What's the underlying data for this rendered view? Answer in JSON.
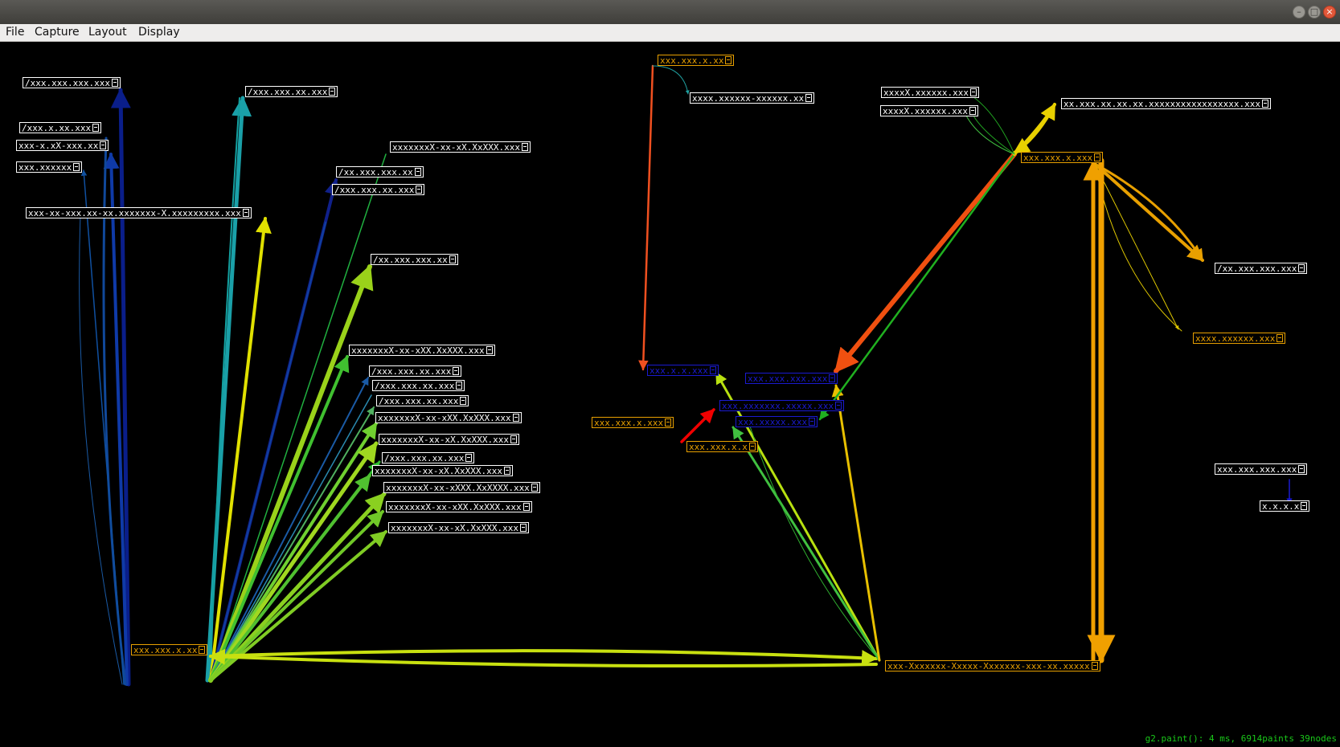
{
  "window": {
    "buttons": [
      "minimize",
      "maximize",
      "close"
    ]
  },
  "menu": {
    "items": [
      "File",
      "Capture",
      "Layout",
      "Display"
    ]
  },
  "status": {
    "text": "g2.paint(): 4 ms, 6914paints 39nodes"
  },
  "colors": {
    "node_default": "#ffffff",
    "node_orange": "#e8a000",
    "node_blue": "#1a1ad0",
    "status": "#19c819",
    "background": "#000000"
  },
  "nodes": [
    {
      "label": "/xxx.xxx.xxx.xxx",
      "style": "white"
    },
    {
      "label": "/xxx.x.xx.xxx",
      "style": "white"
    },
    {
      "label": "xxx-x.xX-xxx.xx",
      "style": "white"
    },
    {
      "label": "xxx.xxxxxx",
      "style": "white"
    },
    {
      "label": "xxx-xx-xxx.xx-xx.xxxxxxx-X.xxxxxxxxx.xxx",
      "style": "white"
    },
    {
      "label": "/xxx.xxx.xx.xxx",
      "style": "white"
    },
    {
      "label": "xxxxxxxX-xx-xX.XxXXX.xxx",
      "style": "white"
    },
    {
      "label": "/xx.xxx.xxx.xx",
      "style": "white"
    },
    {
      "label": "/xxx.xxx.xx.xxx",
      "style": "white"
    },
    {
      "label": "/xx.xxx.xxx.xx",
      "style": "white"
    },
    {
      "label": "xxxxxxxX-xx-xXX.XxXXX.xxx",
      "style": "white"
    },
    {
      "label": "/xxx.xxx.xx.xxx",
      "style": "white"
    },
    {
      "label": "/xxx.xxx.xx.xxx",
      "style": "white"
    },
    {
      "label": "/xxx.xxx.xx.xxx",
      "style": "white"
    },
    {
      "label": "xxxxxxxX-xx-xXX.XxXXX.xxx",
      "style": "white"
    },
    {
      "label": "xxxxxxxX-xx-xX.XxXXX.xxx",
      "style": "white"
    },
    {
      "label": "/xxx.xxx.xx.xxx",
      "style": "white"
    },
    {
      "label": "xxxxxxxX-xx-xX.XxXXX.xxx",
      "style": "white"
    },
    {
      "label": "xxxxxxxX-xx-xXXX.XxXXXX.xxx",
      "style": "white"
    },
    {
      "label": "xxxxxxxX-xx-xXX.XxXXX.xxx",
      "style": "white"
    },
    {
      "label": "xxxxxxxX-xx-xX.XxXXX.xxx",
      "style": "white"
    },
    {
      "label": "xxx.xxx.x.xx",
      "style": "orange"
    },
    {
      "label": "xxx.xxx.x.xx",
      "style": "orange"
    },
    {
      "label": "xxxx.xxxxxx-xxxxxx.xx",
      "style": "white"
    },
    {
      "label": "xxx.x.x.xxx",
      "style": "blue"
    },
    {
      "label": "xxx.xxx.xxx.xxx",
      "style": "blue"
    },
    {
      "label": "xxx.xxxxxxx.xxxxx.xxx",
      "style": "blue"
    },
    {
      "label": "xxx.xxx.x.xxx",
      "style": "orange"
    },
    {
      "label": "xxx.xxxxx.xxx",
      "style": "blue"
    },
    {
      "label": "xxx.xxx.x.x",
      "style": "orange"
    },
    {
      "label": "xxxxX.xxxxxx.xxx",
      "style": "white"
    },
    {
      "label": "xxxxX.xxxxxx.xxx",
      "style": "white"
    },
    {
      "label": "xx.xxx.xx.xx.xx.xxxxxxxxxxxxxxxxx.xxx",
      "style": "white"
    },
    {
      "label": "xxx.xxx.x.xxx",
      "style": "orange"
    },
    {
      "label": "/xx.xxx.xxx.xxx",
      "style": "white"
    },
    {
      "label": "xxxx.xxxxxx.xxx",
      "style": "orange"
    },
    {
      "label": "xxx.xxx.xxx.xxx",
      "style": "white"
    },
    {
      "label": "x.x.x.x",
      "style": "white"
    },
    {
      "label": "xxx-Xxxxxxx-Xxxxx-Xxxxxxx-xxx-xx.xxxxx",
      "style": "orange"
    }
  ]
}
